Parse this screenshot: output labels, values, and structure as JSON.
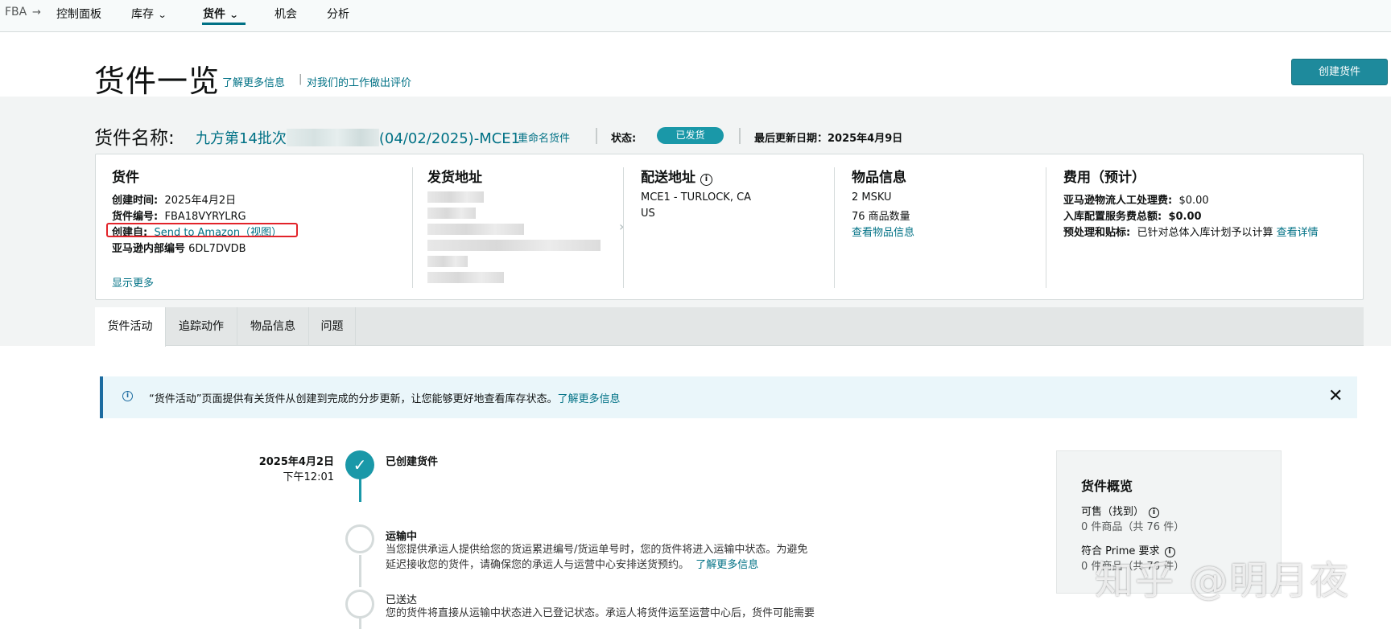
{
  "nav": {
    "crumb": "FBA",
    "crumb_arrow": "→",
    "items": [
      "控制面板",
      "库存",
      "货件",
      "机会",
      "分析"
    ]
  },
  "header": {
    "title": "货件一览",
    "learn_more": "了解更多信息",
    "separator": "|",
    "feedback": "对我们的工作做出评价",
    "create_button": "创建货件"
  },
  "shipment": {
    "label": "货件名称:",
    "name_prefix": "九方第14批次",
    "name_suffix": "(04/02/2025)-MCE1",
    "rename": "重命名货件",
    "status_label": "状态:",
    "status": "已发货",
    "updated": "最后更新日期：2025年4月9日"
  },
  "summary": {
    "shipment": {
      "title": "货件",
      "created_label": "创建时间:",
      "created_value": "2025年4月2日",
      "id_label": "货件编号:",
      "id_value": "FBA18VYRYLRG",
      "created_from_label": "创建自:",
      "created_from_value": "Send to Amazon（视图）",
      "internal_label": "亚马逊内部编号",
      "internal_value": "6DL7DVDB",
      "show_more": "显示更多"
    },
    "ship_from": {
      "title": "发货地址"
    },
    "ship_to": {
      "title": "配送地址",
      "line1": "MCE1 - TURLOCK, CA",
      "line2": "US"
    },
    "items": {
      "title": "物品信息",
      "msku": "2 MSKU",
      "qty": "76 商品数量",
      "view": "查看物品信息"
    },
    "fees": {
      "title": "费用（预计）",
      "manual_label": "亚马逊物流人工处理费:",
      "manual_value": "$0.00",
      "placement_label": "入库配置服务费总额:",
      "placement_value": "$0.00",
      "prep_label": "预处理和贴标:",
      "prep_value": "已针对总体入库计划予以计算",
      "prep_link": "查看详情"
    }
  },
  "tabs": [
    "货件活动",
    "追踪动作",
    "物品信息",
    "问题"
  ],
  "alert": {
    "message": "“货件活动”页面提供有关货件从创建到完成的分步更新，让您能够更好地查看库存状态。",
    "link": "了解更多信息",
    "close": "✕"
  },
  "timeline": [
    {
      "date": "2025年4月2日",
      "time": "下午12:01",
      "title": "已创建货件",
      "done": true
    },
    {
      "title": "运输中",
      "line1": "当您提供承运人提供给您的货运累进编号/货运单号时，您的货件将进入运输中状态。为避免",
      "line2": "延迟接收您的货件，请确保您的承运人与运营中心安排送货预约。",
      "link": "了解更多信息",
      "done": false
    },
    {
      "title": "已送达",
      "line1": "您的货件将直接从运输中状态进入已登记状态。承运人将货件运至运营中心后，货件可能需要",
      "done": false
    }
  ],
  "overview": {
    "title": "货件概览",
    "sellable_label": "可售（找到）",
    "sellable_value": "0 件商品（共 76 件）",
    "prime_label": "符合 Prime 要求",
    "prime_value": "0 件商品（共 76 件）"
  },
  "watermark": "知乎 @明月夜",
  "colors": {
    "accent": "#007185",
    "button": "#1e8a9c",
    "badge": "#1a98a8",
    "highlight": "#e2232a"
  }
}
